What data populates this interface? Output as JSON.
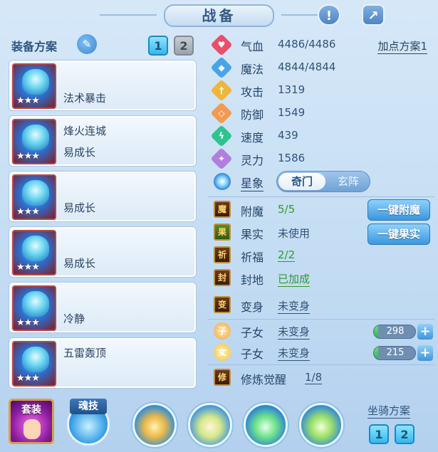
{
  "header": {
    "title": "战备",
    "info_icon": "exclamation-icon",
    "share_icon": "share-icon"
  },
  "left": {
    "plan_label": "装备方案",
    "edit_icon": "pencil-icon",
    "plan_tabs": [
      "1",
      "2"
    ],
    "active_plan": "1",
    "pets": [
      {
        "stars": "★★★",
        "line1": "",
        "line2": "法术暴击"
      },
      {
        "stars": "★★★",
        "line1": "烽火连城",
        "line2": "易成长"
      },
      {
        "stars": "★★★",
        "line1": "",
        "line2": "易成长"
      },
      {
        "stars": "★★★",
        "line1": "",
        "line2": "易成长"
      },
      {
        "stars": "★★★",
        "line1": "",
        "line2": "冷静"
      },
      {
        "stars": "★★★",
        "line1": "五雷轰顶",
        "line2": ""
      }
    ]
  },
  "right": {
    "add_point_plan": "加点方案1",
    "stats": [
      {
        "name": "气血",
        "value": "4486/4486",
        "color": "#e8506a",
        "icon": "heart-icon",
        "glyph": "♥"
      },
      {
        "name": "魔法",
        "value": "4844/4844",
        "color": "#4aa3e8",
        "icon": "mana-icon",
        "glyph": "◆"
      },
      {
        "name": "攻击",
        "value": "1319",
        "color": "#f0b53a",
        "icon": "sword-icon",
        "glyph": "†"
      },
      {
        "name": "防御",
        "value": "1549",
        "color": "#f39a52",
        "icon": "shield-icon",
        "glyph": "◇"
      },
      {
        "name": "速度",
        "value": "439",
        "color": "#2fc38f",
        "icon": "speed-icon",
        "glyph": "ϟ"
      },
      {
        "name": "灵力",
        "value": "1586",
        "color": "#b17ee0",
        "icon": "spirit-icon",
        "glyph": "✦"
      }
    ],
    "star_label": "星象",
    "star_toggle": [
      "奇门",
      "玄阵"
    ],
    "features": [
      {
        "name": "附魔",
        "value": "5/5",
        "green": true,
        "underline": false,
        "icon": "enchant-icon"
      },
      {
        "name": "果实",
        "value": "未使用",
        "green": false,
        "underline": false,
        "icon": "fruit-icon"
      },
      {
        "name": "祈福",
        "value": "2/2",
        "green": true,
        "underline": true,
        "icon": "blessing-icon"
      },
      {
        "name": "封地",
        "value": "已加成",
        "green": true,
        "underline": true,
        "icon": "fief-icon"
      },
      {
        "name": "变身",
        "value": "未变身",
        "green": false,
        "underline": true,
        "icon": "transform-icon"
      }
    ],
    "buttons": [
      "一键附魔",
      "一键果实"
    ],
    "children": [
      {
        "name": "子女",
        "value": "未变身",
        "progress": "298",
        "icon": "child-icon-1"
      },
      {
        "name": "子女",
        "value": "未变身",
        "progress": "215",
        "icon": "child-icon-2"
      }
    ],
    "cultivation": {
      "name": "修炼觉醒",
      "value": "1/8",
      "icon": "cultivation-icon"
    }
  },
  "bottom": {
    "suit_label": "套装",
    "soul_label": "魂技",
    "mount_label": "坐骑方案",
    "mount_tabs": [
      "1",
      "2"
    ]
  }
}
